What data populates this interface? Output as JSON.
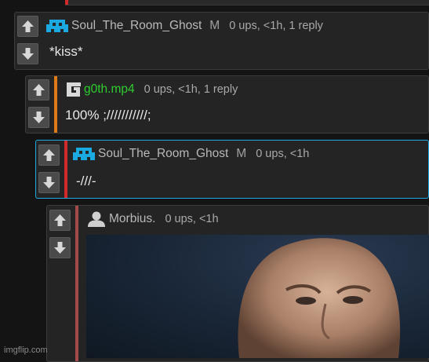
{
  "comments": [
    {
      "username": "Soul_The_Room_Ghost",
      "badge": "M",
      "meta": "0 ups, <1h, 1 reply",
      "text": "*kiss*",
      "accent": "#d02a2a",
      "avatar": "cyan-invader-icon"
    },
    {
      "username": "g0th.mp4",
      "badge": "",
      "meta": "0 ups, <1h, 1 reply",
      "text": "100% ;///////////;",
      "accent": "#e07a16",
      "username_color": "#2fcc2f",
      "avatar": "g-logo-icon"
    },
    {
      "username": "Soul_The_Room_Ghost",
      "badge": "M",
      "meta": "0 ups, <1h",
      "text": "-///-",
      "accent": "#d02a2a",
      "border": "#1aa9e0",
      "avatar": "cyan-invader-icon"
    },
    {
      "username": "Morbius.",
      "badge": "",
      "meta": "0 ups, <1h",
      "text": "",
      "accent": "#a34a4a",
      "avatar": "default-user-icon"
    }
  ],
  "watermark": "imgflip.com"
}
